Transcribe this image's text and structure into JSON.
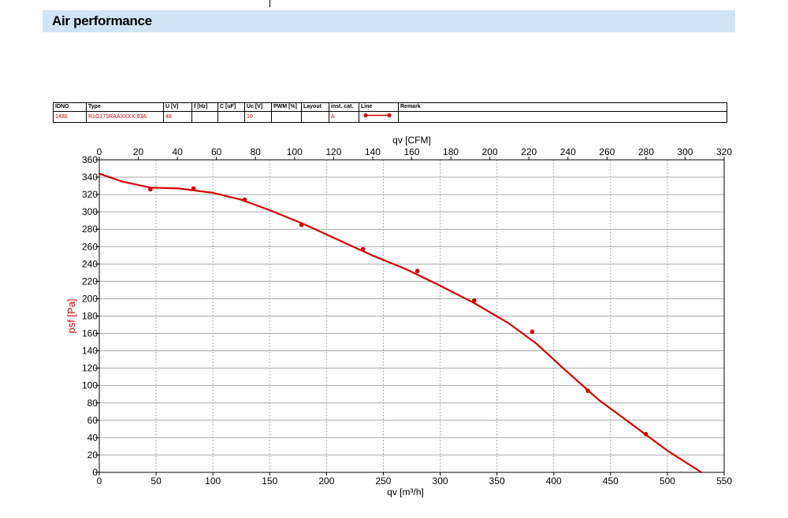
{
  "page": {
    "title": "Air performance"
  },
  "legend": {
    "headers": [
      "IDNO",
      "Type",
      "U [V]",
      "f [Hz]",
      "C [uF]",
      "Uc [V]",
      "PWM [%]",
      "Layout",
      "inst. cat.",
      "Line",
      "Remark"
    ],
    "row": [
      "1430",
      "R1G175RAAXXXX-93A",
      "48",
      "",
      "",
      "10",
      "",
      "",
      "A",
      "",
      ""
    ],
    "line_color": "#d40000"
  },
  "chart_data": {
    "type": "line",
    "xlabel": "qv [m³/h]",
    "x2label": "qv [CFM]",
    "ylabel": "psf [Pa]",
    "xlim": [
      0,
      550
    ],
    "x2lim": [
      0,
      320
    ],
    "ylim": [
      0,
      360
    ],
    "xticks": [
      0,
      50,
      100,
      150,
      200,
      250,
      300,
      350,
      400,
      450,
      500,
      550
    ],
    "x2ticks": [
      0,
      20,
      40,
      60,
      80,
      100,
      120,
      140,
      160,
      180,
      200,
      220,
      240,
      260,
      280,
      300,
      320
    ],
    "yticks": [
      0,
      20,
      40,
      60,
      80,
      100,
      120,
      140,
      160,
      180,
      200,
      220,
      240,
      260,
      280,
      300,
      320,
      340,
      360
    ],
    "grid": true,
    "series_color": "#d40000",
    "curve": {
      "x": [
        0,
        20,
        45,
        70,
        100,
        125,
        150,
        180,
        210,
        240,
        270,
        300,
        330,
        360,
        385,
        410,
        440,
        470,
        500,
        530
      ],
      "y": [
        344,
        335,
        328,
        327,
        322,
        314,
        302,
        286,
        268,
        250,
        234,
        215,
        195,
        172,
        148,
        118,
        83,
        54,
        25,
        0
      ]
    },
    "markers": {
      "x": [
        45,
        83,
        128,
        178,
        232,
        280,
        330,
        381,
        430,
        481
      ],
      "y": [
        326,
        327,
        314,
        285,
        257,
        232,
        198,
        162,
        94,
        44
      ]
    }
  }
}
